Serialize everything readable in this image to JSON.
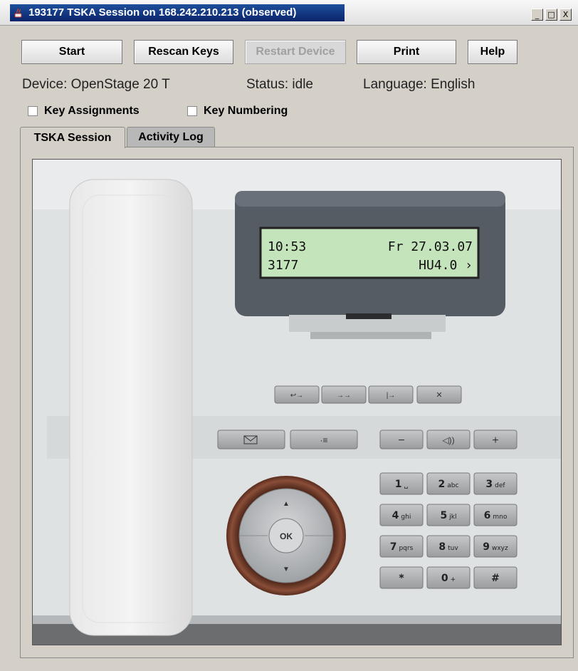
{
  "window": {
    "title": "193177 TSKA Session on 168.242.210.213 (observed)",
    "controls": {
      "minimize": "_",
      "maximize": "□",
      "close": "X"
    }
  },
  "toolbar": {
    "start": "Start",
    "rescan_keys": "Rescan Keys",
    "restart_device": "Restart Device",
    "print": "Print",
    "help": "Help"
  },
  "info": {
    "device": "Device: OpenStage 20 T",
    "status": "Status: idle",
    "language": "Language: English"
  },
  "options": {
    "key_assignments": "Key Assignments",
    "key_numbering": "Key Numbering"
  },
  "tabs": {
    "session": "TSKA Session",
    "activity_log": "Activity Log"
  },
  "phone": {
    "display": {
      "time": "10:53",
      "date": "Fr 27.03.07",
      "number": "3177",
      "version": "HU4.0 ›"
    },
    "nav_ok": "OK",
    "keypad": [
      {
        "digit": "1",
        "letters": "␣"
      },
      {
        "digit": "2",
        "letters": "abc"
      },
      {
        "digit": "3",
        "letters": "def"
      },
      {
        "digit": "4",
        "letters": "ghi"
      },
      {
        "digit": "5",
        "letters": "jkl"
      },
      {
        "digit": "6",
        "letters": "mno"
      },
      {
        "digit": "7",
        "letters": "pqrs"
      },
      {
        "digit": "8",
        "letters": "tuv"
      },
      {
        "digit": "9",
        "letters": "wxyz"
      },
      {
        "digit": "*",
        "letters": ""
      },
      {
        "digit": "0",
        "letters": "+"
      },
      {
        "digit": "#",
        "letters": ""
      }
    ],
    "volume_minus": "−",
    "volume_plus": "+",
    "colors": {
      "body": "#e8eaea",
      "display_bg": "#c4e4bc",
      "display_housing": "#565c64",
      "nav_ring": "#6e3a2a",
      "key": "#a9abad"
    }
  }
}
